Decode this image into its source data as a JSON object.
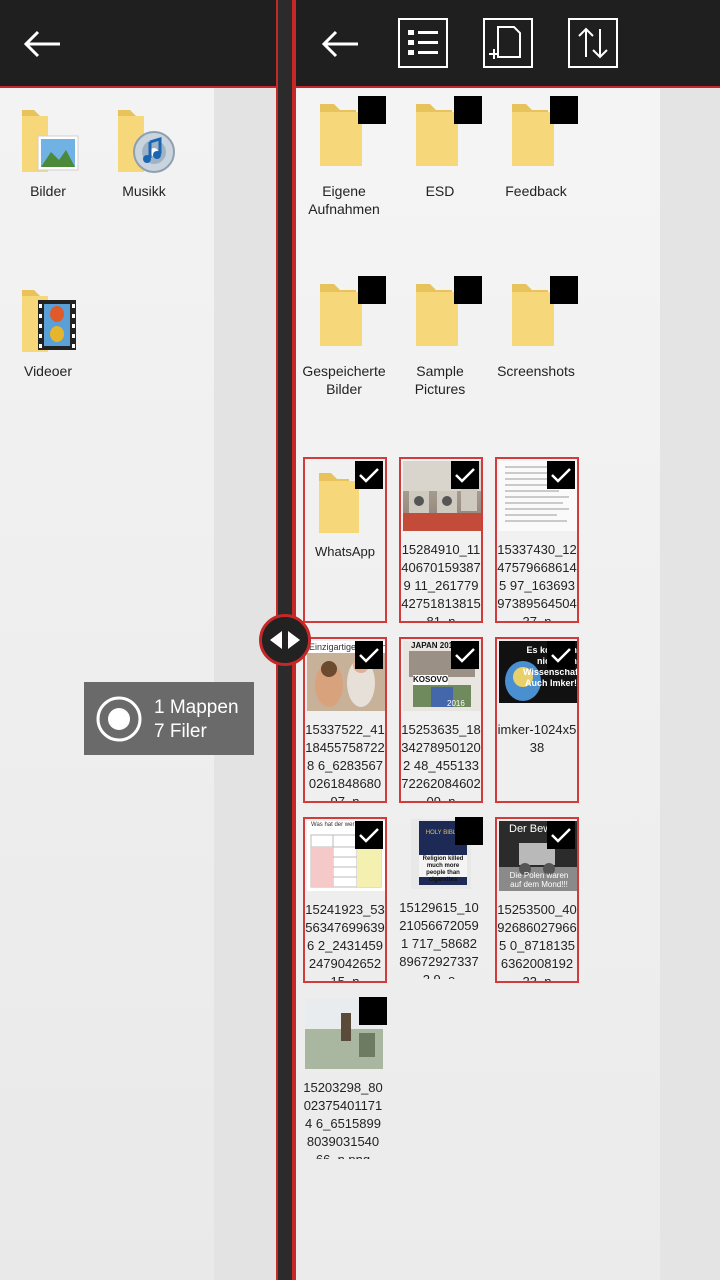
{
  "left_pane": {
    "header": {
      "back_icon": "arrow-left-icon"
    },
    "items": [
      {
        "label": "Bilder",
        "icon": "pictures-folder-icon"
      },
      {
        "label": "Musikk",
        "icon": "music-folder-icon"
      },
      {
        "label": "Videoer",
        "icon": "videos-folder-icon"
      }
    ]
  },
  "right_pane": {
    "header": {
      "back_icon": "arrow-left-icon",
      "list_view_icon": "list-view-icon",
      "new_folder_icon": "new-folder-icon",
      "sort_icon": "sort-icon"
    },
    "folders": [
      {
        "label_line1": "Eigene",
        "label_line2": "Aufnahmen",
        "selected": false
      },
      {
        "label_line1": "ESD",
        "label_line2": "",
        "selected": false
      },
      {
        "label_line1": "Feedback",
        "label_line2": "",
        "selected": false
      },
      {
        "label_line1": "Gespeicherte",
        "label_line2": "Bilder",
        "selected": false
      },
      {
        "label_line1": "Sample",
        "label_line2": "Pictures",
        "selected": false
      },
      {
        "label_line1": "Screenshots",
        "label_line2": "",
        "selected": false
      }
    ],
    "tiles": [
      {
        "name": "WhatsApp",
        "kind": "folder",
        "selected": true
      },
      {
        "name": "15284910_11406701593879 11_26177942751813815 81_n",
        "kind": "photo",
        "selected": true
      },
      {
        "name": "15337430_12475796686145 97_16369397389564504 37_n",
        "kind": "document",
        "selected": true
      },
      {
        "name": "15337522_41184557587228 6_62835670261848680 97_n",
        "kind": "photo",
        "overlay_text": "Einzigartige Aufnah",
        "selected": true
      },
      {
        "name": "15253635_18342789501202 48_45513372262084602 09_n",
        "kind": "photo",
        "overlay_text_top": "JAPAN 2016",
        "overlay_text_mid": "KOSOVO",
        "overlay_text_bottom": "2016",
        "selected": true
      },
      {
        "name": "imker-1024x538",
        "kind": "photo",
        "overlay_text": "Es kommen nicht von Wissenschaftler. Auch Imker!",
        "selected": true
      },
      {
        "name": "15241923_53563476996396 2_24314592479042652 15_n",
        "kind": "document",
        "overlay_text": "Was hat der wer letzte Fernsehrechner?",
        "selected": true
      },
      {
        "name": "15129615_10210566720591 717_58682896729273372 9_o",
        "kind": "photo",
        "overlay_text_top": "HOLY BIBLE",
        "overlay_text_bottom": "Religion killed much more people than cigarettes",
        "selected": false
      },
      {
        "name": "15253500_40926860279665 0_87181356362008192 23_n",
        "kind": "photo",
        "overlay_text_top": "Der Bew",
        "overlay_text_bottom": "Die Polen waren auf dem Mond!!!",
        "selected": true
      },
      {
        "name": "15203298_80023754011714 6_65158998039031540 66_n.png",
        "kind": "photo",
        "selected": false
      }
    ]
  },
  "selection_toast": {
    "icon": "record-icon",
    "folders_text": "1 Mappen",
    "files_text": "7 Filer"
  },
  "split_handle": {
    "icon": "split-arrows-icon"
  },
  "colors": {
    "accent": "#c62828",
    "folder": "#f6d77a",
    "header": "#1f1f1f"
  }
}
